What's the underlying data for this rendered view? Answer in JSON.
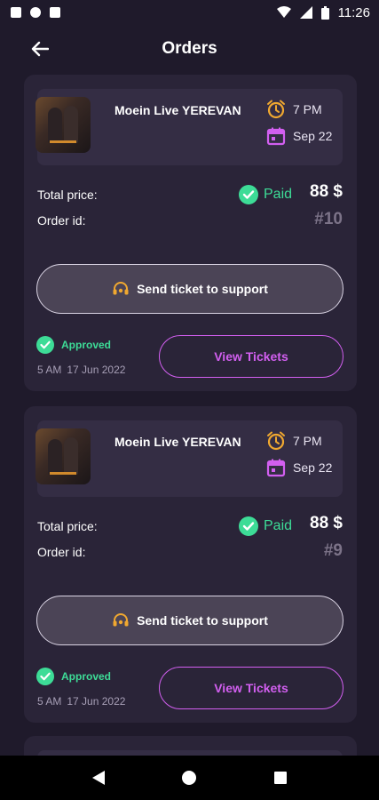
{
  "status_bar": {
    "time": "11:26"
  },
  "header": {
    "title": "Orders"
  },
  "orders": [
    {
      "event_title": "Moein Live YEREVAN",
      "time": "7 PM",
      "date": "Sep 22",
      "total_label": "Total price:",
      "order_id_label": "Order id:",
      "payment_status": "Paid",
      "price": "88 $",
      "order_id": "#10",
      "support_label": "Send ticket to support",
      "approval_status": "Approved",
      "stamp_time": "5 AM",
      "stamp_date": "17 Jun 2022",
      "view_label": "View Tickets"
    },
    {
      "event_title": "Moein Live YEREVAN",
      "time": "7 PM",
      "date": "Sep 22",
      "total_label": "Total price:",
      "order_id_label": "Order id:",
      "payment_status": "Paid",
      "price": "88 $",
      "order_id": "#9",
      "support_label": "Send ticket to support",
      "approval_status": "Approved",
      "stamp_time": "5 AM",
      "stamp_date": "17 Jun 2022",
      "view_label": "View Tickets"
    }
  ],
  "colors": {
    "background": "#1f1a2b",
    "card": "#2a2438",
    "accent_purple": "#d25ff0",
    "success_green": "#3ddc97",
    "time_icon_orange": "#f0a830",
    "calendar_icon_purple": "#d25ff0"
  }
}
